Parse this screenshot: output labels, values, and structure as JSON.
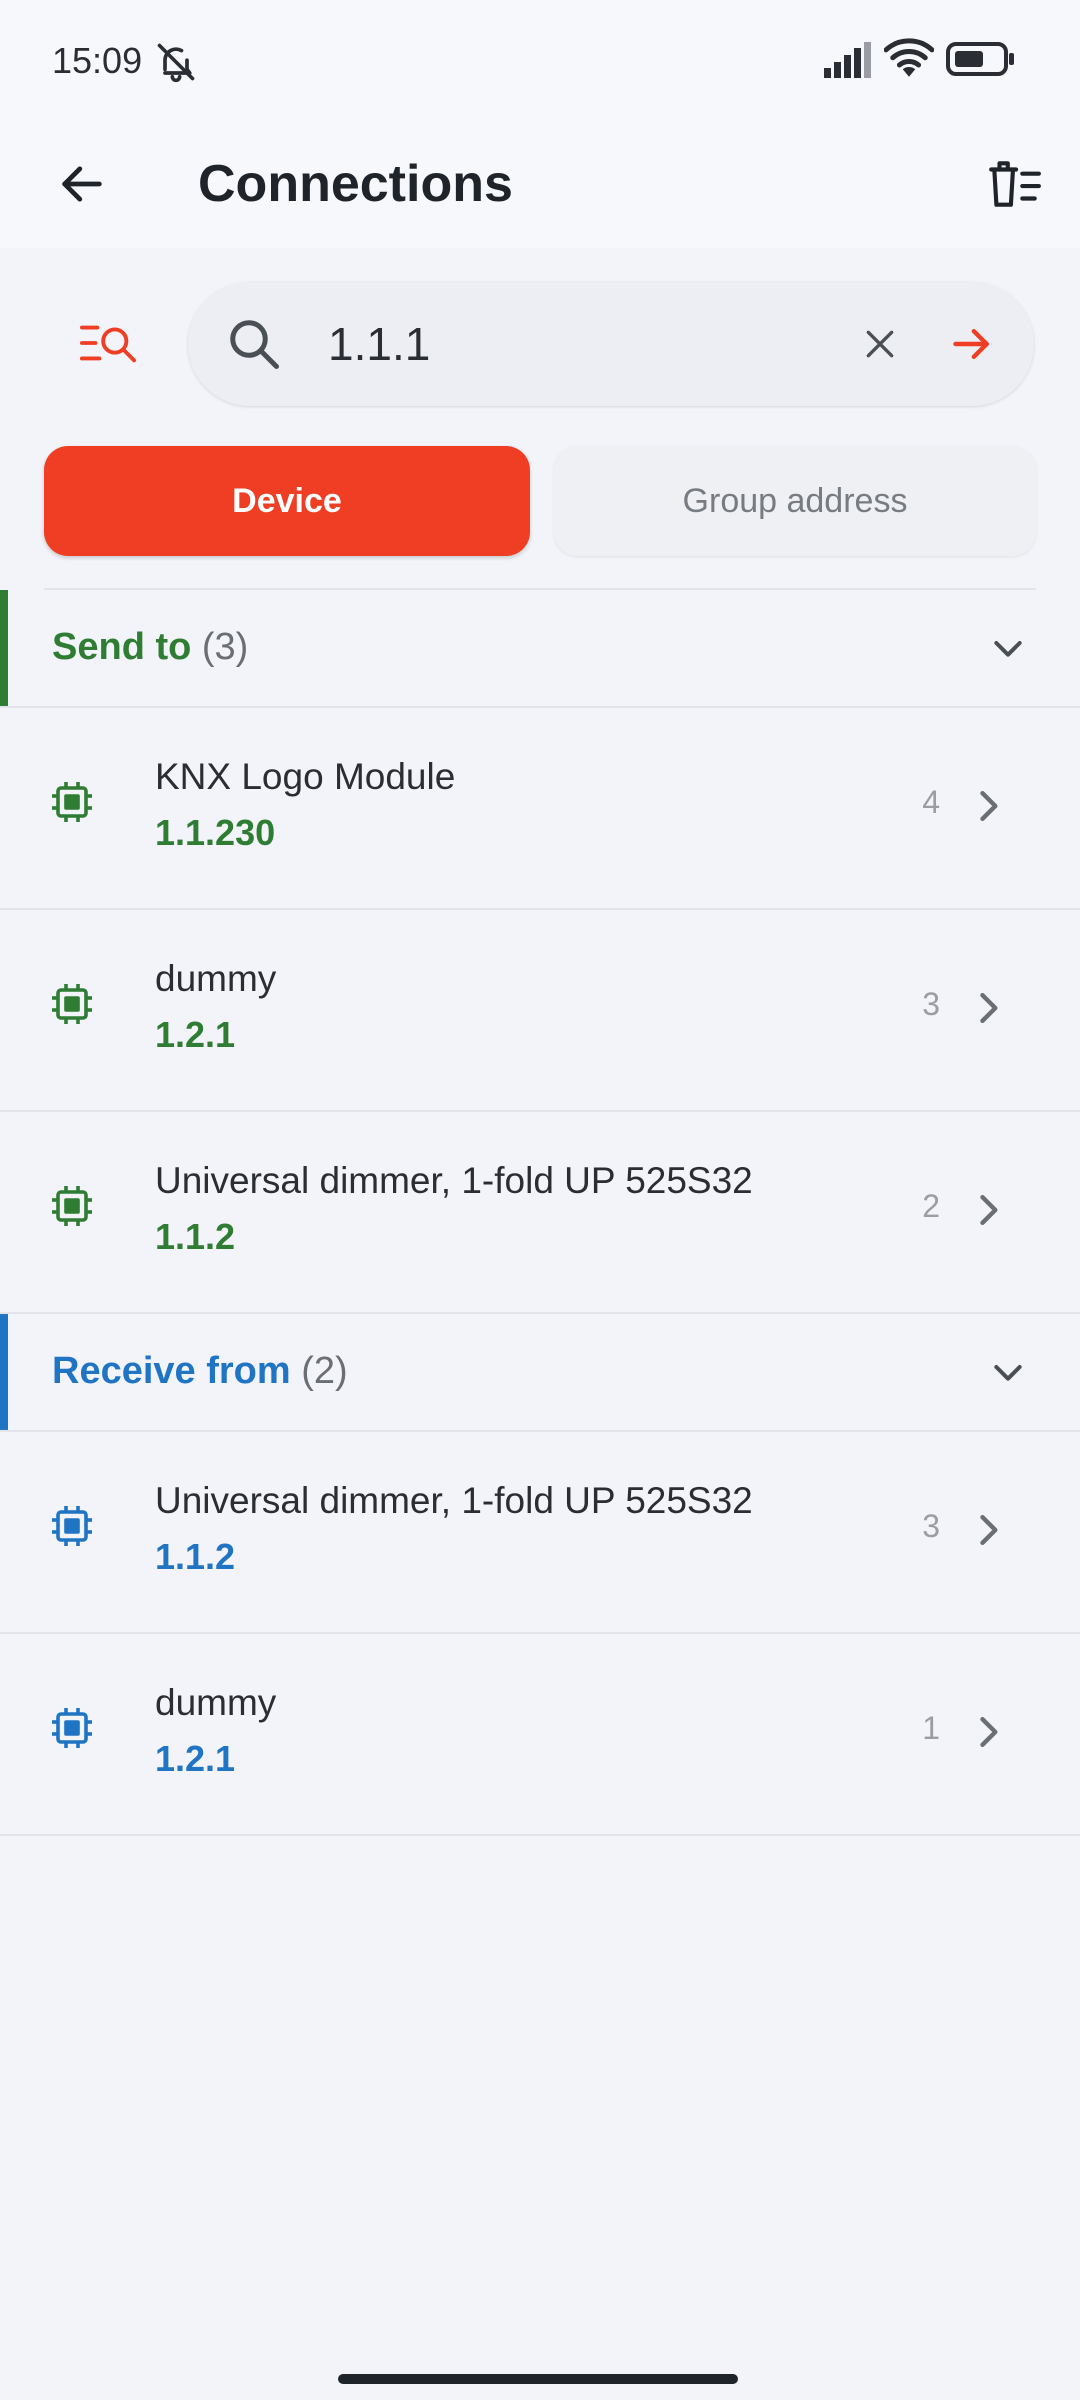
{
  "status_bar": {
    "time": "15:09",
    "icons": [
      "bell-off-icon",
      "signal-icon",
      "wifi-icon",
      "battery-icon"
    ]
  },
  "app_bar": {
    "title": "Connections",
    "back_icon": "arrow-left-icon",
    "action_icon": "clear-list-icon"
  },
  "search": {
    "filter_icon": "filter-search-icon",
    "value": "1.1.1",
    "placeholder": "",
    "clear_icon": "close-icon",
    "go_icon": "arrow-right-icon"
  },
  "tabs": [
    {
      "label": "Device",
      "active": true
    },
    {
      "label": "Group address",
      "active": false
    }
  ],
  "sections": [
    {
      "label": "Send to",
      "count": "(3)",
      "color": "#2e7d32",
      "items": [
        {
          "name": "KNX Logo Module",
          "address": "1.1.230",
          "count": "4"
        },
        {
          "name": "dummy",
          "address": "1.2.1",
          "count": "3"
        },
        {
          "name": "Universal dimmer, 1-fold UP 525S32",
          "address": "1.1.2",
          "count": "2"
        }
      ]
    },
    {
      "label": "Receive from",
      "count": "(2)",
      "color": "#1f74c4",
      "items": [
        {
          "name": "Universal dimmer, 1-fold UP 525S32",
          "address": "1.1.2",
          "count": "3"
        },
        {
          "name": "dummy",
          "address": "1.2.1",
          "count": "1"
        }
      ]
    }
  ],
  "colors": {
    "accent": "#ef3e23",
    "send": "#2e7d32",
    "receive": "#1f74c4",
    "background": "#f3f4f9"
  }
}
